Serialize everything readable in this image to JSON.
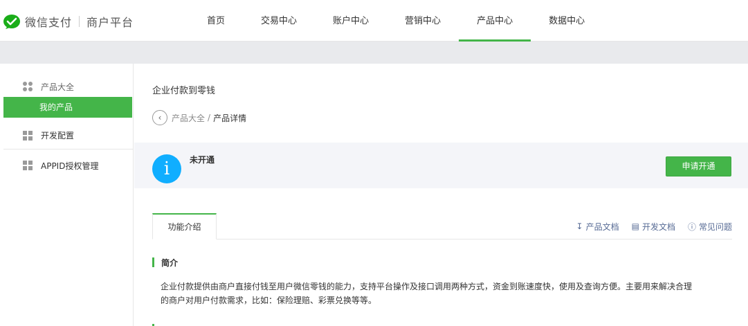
{
  "header": {
    "brand": "微信支付",
    "subtitle": "商户平台",
    "nav": [
      {
        "label": "首页",
        "active": false
      },
      {
        "label": "交易中心",
        "active": false
      },
      {
        "label": "账户中心",
        "active": false
      },
      {
        "label": "营销中心",
        "active": false
      },
      {
        "label": "产品中心",
        "active": true
      },
      {
        "label": "数据中心",
        "active": false
      }
    ],
    "accent_color": "#44b549"
  },
  "sidebar": {
    "group_title": "产品大全",
    "active_item": "我的产品",
    "items": [
      {
        "label": "开发配置",
        "icon": "grid-icon"
      },
      {
        "label": "APPID授权管理",
        "icon": "grid-icon"
      }
    ]
  },
  "main": {
    "title": "企业付款到零钱",
    "breadcrumb": {
      "parent": "产品大全",
      "separator": "/",
      "current": "产品详情"
    },
    "status": {
      "text": "未开通",
      "icon": "info-icon",
      "icon_color": "#10aeff",
      "action_label": "申请开通"
    },
    "tabs": [
      {
        "label": "功能介绍",
        "active": true
      }
    ],
    "doc_links": [
      {
        "label": "产品文档",
        "icon": "download-icon"
      },
      {
        "label": "开发文档",
        "icon": "document-icon"
      },
      {
        "label": "常见问题",
        "icon": "help-icon"
      }
    ],
    "section": {
      "title": "简介",
      "body_line1": "企业付款提供由商户直接付钱至用户微信零钱的能力，支持平台操作及接口调用两种方式，资金到账速度快，使用及查询方便。主要用来解决合理",
      "body_line2": "的商户对用户付款需求，比如：保险理赔、彩票兑换等等。"
    }
  }
}
